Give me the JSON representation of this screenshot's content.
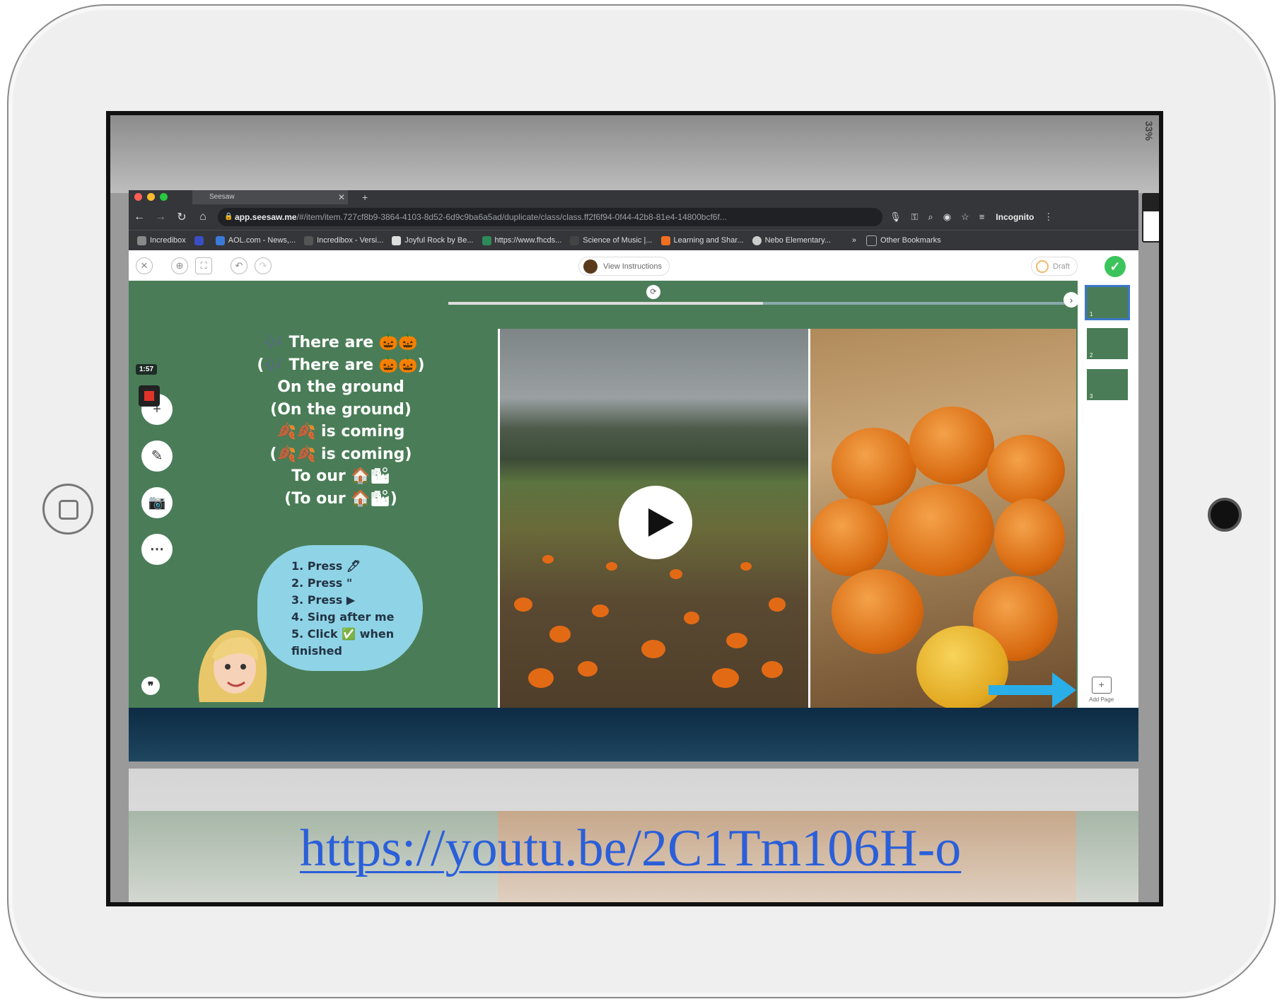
{
  "device": {
    "label": "iPad",
    "zoom_percent": "33%"
  },
  "browser": {
    "tab_title": "Seesaw",
    "url_host": "app.seesaw.me",
    "url_path": "/#/item/item.727cf8b9-3864-4103-8d52-6d9c9ba6a5ad/duplicate/class/class.ff2f6f94-0f44-42b8-81e4-14800bcf6f...",
    "profile": "Incognito",
    "bookmarks": [
      {
        "label": "Incredibox",
        "color": "#888888"
      },
      {
        "label": "",
        "color": "#3a4ec4"
      },
      {
        "label": "AOL.com - News,...",
        "color": "#3a7ad8"
      },
      {
        "label": "Incredibox - Versi...",
        "color": "#555555"
      },
      {
        "label": "Joyful Rock by Be...",
        "color": "#dddddd"
      },
      {
        "label": "https://www.fhcds...",
        "color": "#2e8a5a"
      },
      {
        "label": "Science of Music |...",
        "color": "#444444"
      },
      {
        "label": "Learning and Shar...",
        "color": "#f07020"
      },
      {
        "label": "Nebo Elementary...",
        "color": "#cccccc"
      }
    ],
    "other_bookmarks": "Other Bookmarks"
  },
  "toolbar": {
    "view_instructions": "View Instructions",
    "draft": "Draft"
  },
  "recorder": {
    "timer": "1:57"
  },
  "slide": {
    "lyrics": [
      "🎶 There are 🎃🎃",
      "(🎶 There are 🎃🎃)",
      "On the ground",
      "(On the ground)",
      "🍂🍂 is coming",
      "(🍂🍂 is coming)",
      "To our 🏠🏙",
      "(To our 🏠🏙)"
    ],
    "instructions": [
      "1. Press 🖊",
      "2. Press \"",
      "3. Press ▶",
      "4. Sing after me",
      "5. Click ✅ when",
      "finished"
    ]
  },
  "pages": {
    "items": [
      "1",
      "2",
      "3"
    ],
    "add_page": "Add Page"
  },
  "video_link": "https://youtu.be/2C1Tm106H-o",
  "colors": {
    "canvas_green": "#4a7d57",
    "bubble_blue": "#8fd4e6",
    "link_blue": "#2b5fd9",
    "arrow_blue": "#29aee8",
    "check_green": "#3cc45c"
  }
}
